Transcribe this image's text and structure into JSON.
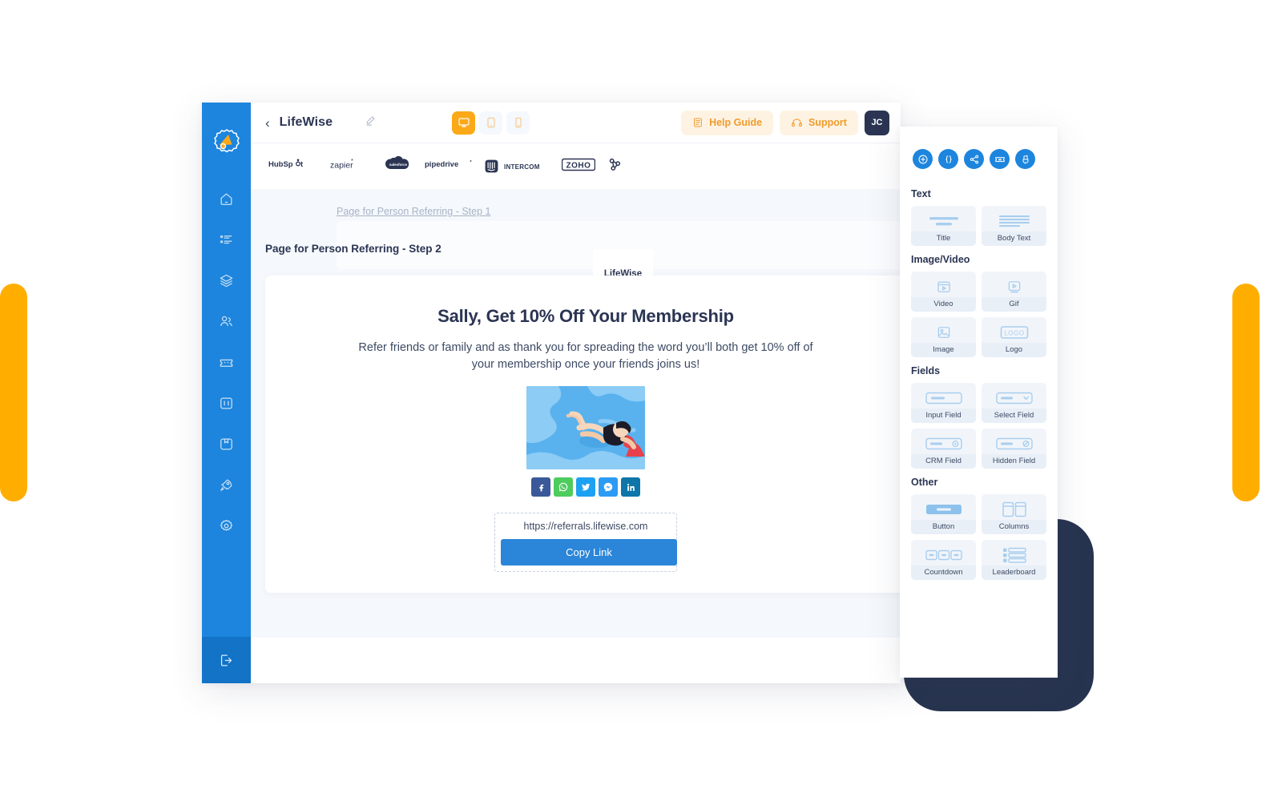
{
  "colors": {
    "brand_blue": "#1D85DD",
    "accent_orange": "#FBA919",
    "deco_orange": "#FFAE00",
    "navy": "#27344F",
    "canvas_bg": "#F5F8FC",
    "pill_bg": "#FEF3E3",
    "pill_text": "#F09B2B"
  },
  "sidebar": {
    "logo": "megaphone-logo",
    "items": [
      {
        "icon": "home-icon",
        "name": "home"
      },
      {
        "icon": "list-icon",
        "name": "campaigns"
      },
      {
        "icon": "layers-icon",
        "name": "layers"
      },
      {
        "icon": "users-icon",
        "name": "participants"
      },
      {
        "icon": "ticket-icon",
        "name": "rewards"
      },
      {
        "icon": "chart-bar-icon",
        "name": "analytics"
      },
      {
        "icon": "box-icon",
        "name": "assets"
      },
      {
        "icon": "rocket-icon",
        "name": "launch"
      },
      {
        "icon": "gear-icon",
        "name": "settings"
      }
    ],
    "bottom": {
      "icon": "logout-icon",
      "name": "logout"
    }
  },
  "header": {
    "back_label": "‹",
    "project_title": "LifeWise",
    "edit_icon": "pencil-icon",
    "devices": [
      {
        "label": "desktop",
        "icon": "desktop-icon",
        "active": true
      },
      {
        "label": "tablet",
        "icon": "tablet-icon",
        "active": false
      },
      {
        "label": "mobile",
        "icon": "mobile-icon",
        "active": false
      }
    ],
    "help_label": "Help Guide",
    "support_label": "Support",
    "avatar_initials": "JC"
  },
  "integrations": [
    {
      "name": "HubSpot"
    },
    {
      "name": "zapier"
    },
    {
      "name": "salesforce"
    },
    {
      "name": "pipedrive"
    },
    {
      "name": "INTERCOM"
    },
    {
      "name": "ZOHO"
    },
    {
      "name": "webhook"
    }
  ],
  "canvas": {
    "step1_link": "Page for Person Referring - Step 1",
    "step2_title": "Page for Person Referring - Step 2",
    "brand_chip": "LifeWise",
    "page": {
      "headline": "Sally, Get 10% Off Your Membership",
      "body": "Refer friends or family and as thank you for spreading the word you’ll both get 10% off of your membership once your friends joins us!",
      "image_alt": "woman-floating-in-pool-illustration",
      "socials": [
        {
          "name": "facebook",
          "color": "#3B5998",
          "glyph": "f"
        },
        {
          "name": "whatsapp",
          "color": "#4ECC5E",
          "glyph": "whatsapp-icon"
        },
        {
          "name": "twitter",
          "color": "#1DA1F2",
          "glyph": "twitter-icon"
        },
        {
          "name": "messenger",
          "color": "#2B9BF4",
          "glyph": "messenger-icon"
        },
        {
          "name": "linkedin",
          "color": "#0E76A8",
          "glyph": "in"
        }
      ],
      "referral_url": "https://referrals.lifewise.com",
      "copy_button": "Copy Link"
    }
  },
  "panel": {
    "tools": [
      {
        "name": "add-element",
        "icon": "plus-circle-icon"
      },
      {
        "name": "custom-code",
        "icon": "code-braces-icon"
      },
      {
        "name": "share",
        "icon": "share-icon"
      },
      {
        "name": "coupon",
        "icon": "coupon-icon"
      },
      {
        "name": "brush",
        "icon": "paint-brush-icon"
      }
    ],
    "sections": [
      {
        "title": "Text",
        "items": [
          {
            "label": "Title",
            "icon": "title-glyph"
          },
          {
            "label": "Body Text",
            "icon": "body-text-glyph"
          }
        ]
      },
      {
        "title": "Image/Video",
        "items": [
          {
            "label": "Video",
            "icon": "video-glyph"
          },
          {
            "label": "Gif",
            "icon": "gif-glyph"
          },
          {
            "label": "Image",
            "icon": "image-glyph"
          },
          {
            "label": "Logo",
            "icon": "logo-glyph"
          }
        ]
      },
      {
        "title": "Fields",
        "items": [
          {
            "label": "Input Field",
            "icon": "input-field-glyph"
          },
          {
            "label": "Select Field",
            "icon": "select-field-glyph"
          },
          {
            "label": "CRM Field",
            "icon": "crm-field-glyph"
          },
          {
            "label": "Hidden Field",
            "icon": "hidden-field-glyph"
          }
        ]
      },
      {
        "title": "Other",
        "items": [
          {
            "label": "Button",
            "icon": "button-glyph"
          },
          {
            "label": "Columns",
            "icon": "columns-glyph"
          },
          {
            "label": "Countdown",
            "icon": "countdown-glyph"
          },
          {
            "label": "Leaderboard",
            "icon": "leaderboard-glyph"
          }
        ]
      }
    ]
  }
}
